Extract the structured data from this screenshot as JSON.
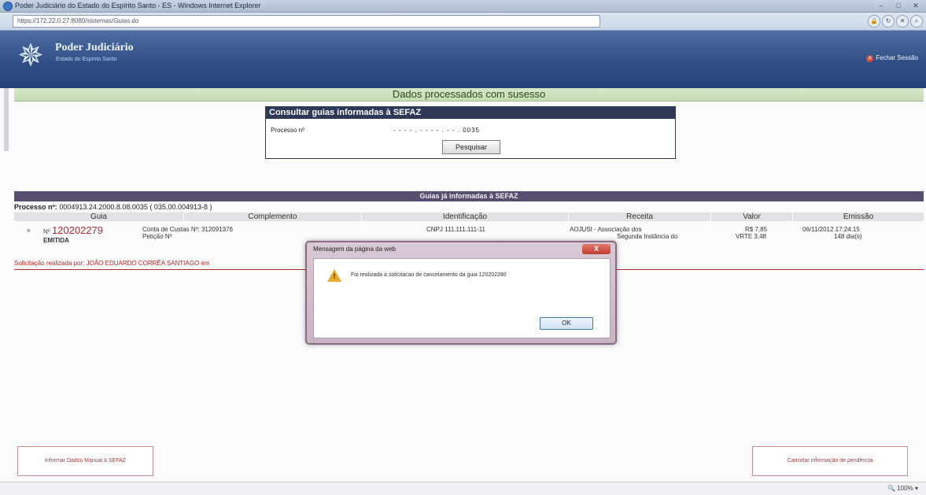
{
  "window": {
    "title": "Poder Judiciário do Estado do Espírito Santo - ES - Windows Internet Explorer",
    "url": "https://172.22.0.27:8080/sistemas/Guias.do"
  },
  "header": {
    "title": "Poder Judiciário",
    "subtitle": "Estado do Espírito Santo",
    "close_session": "Fechar Sessão"
  },
  "banner": {
    "message": "Dados processados com susesso"
  },
  "query": {
    "title": "Consultar guias informadas à SEFAZ",
    "label": "Processo nº",
    "value": "- - - - . - - - - . - - . 0035",
    "button": "Pesquisar"
  },
  "guides": {
    "header": "Guias já informadas à SEFAZ",
    "process_label": "Processo nº:",
    "process_value": "0004913.24.2000.8.08.0035 ( 035.00.004913-8 )",
    "columns": [
      "Guia",
      "Complemento",
      "Identificação",
      "Receita",
      "Valor",
      "Emissão"
    ],
    "rows": [
      {
        "guia_prefix": "Nº",
        "guia_number": "120202279",
        "status": "EMITIDA",
        "complemento_1": "Conta de Custas Nº: 312091376",
        "complemento_2": "Petição Nº",
        "identificacao": "CNPJ 111.111.111-11",
        "receita_1": "AOJUSI - Associação dos",
        "receita_2": "Segunda Instância do",
        "valor_1": "R$ 7,85",
        "valor_2": "VRTE 3,48",
        "emissao_1": "06/11/2012 17:24:15",
        "emissao_2": "148 dia(s)"
      }
    ],
    "requester": "Solicitação realizada por: JOÃO EDUARDO CORRÊA SANTIAGO em"
  },
  "dialog": {
    "title": "Mensagem da página da web",
    "close_label": "X",
    "message": "Foi realizada a solicitacao de cancelamento da guia 120202280",
    "ok_label": "OK"
  },
  "footer": {
    "left_button": "Informar Dados Manual à SEFAZ",
    "right_button": "Cancelar informação de pendência",
    "zoom": "100%"
  },
  "colors": {
    "header_blue": "#2f4f86",
    "banner_green": "#c4dcb4",
    "panel_navy": "#2d3956",
    "guides_purple": "#584e6f",
    "guia_red": "#b4282c"
  }
}
